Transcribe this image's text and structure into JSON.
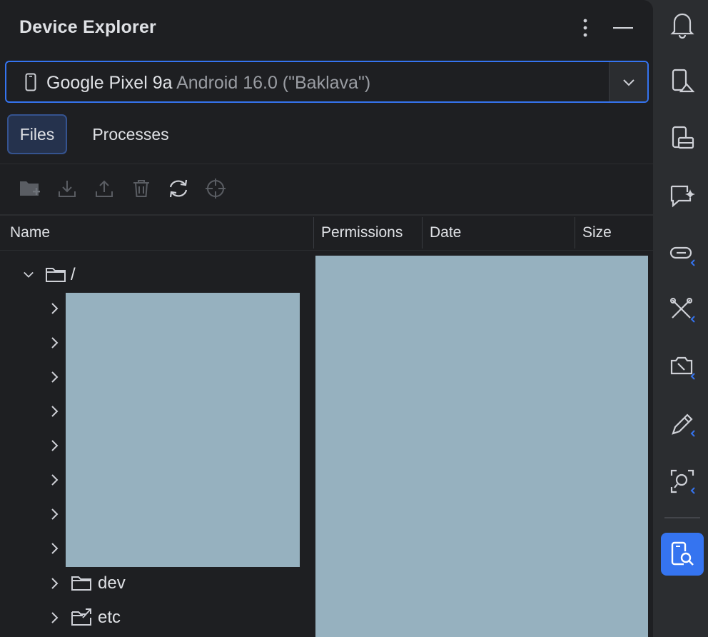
{
  "panel": {
    "title": "Device Explorer"
  },
  "device": {
    "name": "Google Pixel 9a",
    "os": "Android 16.0 (\"Baklava\")"
  },
  "tabs": [
    {
      "label": "Files",
      "selected": true
    },
    {
      "label": "Processes",
      "selected": false
    }
  ],
  "toolbar": {
    "icons": [
      "new-folder-icon",
      "download-icon",
      "upload-icon",
      "delete-icon",
      "sync-icon",
      "locate-icon"
    ]
  },
  "columns": {
    "name": "Name",
    "permissions": "Permissions",
    "date": "Date",
    "size": "Size"
  },
  "tree": {
    "root": {
      "label": "/"
    },
    "visible_items": [
      {
        "label": "dev",
        "icon": "folder-icon"
      },
      {
        "label": "etc",
        "icon": "folder-link-icon"
      }
    ]
  },
  "sidebar": {
    "icons": [
      "notifications-icon",
      "running-devices-icon",
      "device-manager-icon",
      "gemini-chat-icon",
      "app-links-icon",
      "app-inspection-icon",
      "device-mirroring-icon",
      "layout-inspector-icon",
      "screen-capture-icon",
      "device-explorer-icon"
    ],
    "active": "device-explorer-icon"
  },
  "colors": {
    "accent": "#3574f0",
    "panel_bg": "#1e1f22",
    "strip_bg": "#2b2d30",
    "redaction": "#96b1bf"
  }
}
